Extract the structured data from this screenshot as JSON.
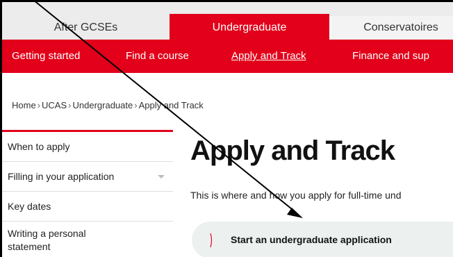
{
  "top_tabs": [
    {
      "label": "After GCSEs"
    },
    {
      "label": "Undergraduate"
    },
    {
      "label": "Conservatoires"
    }
  ],
  "nav": [
    {
      "label": "Getting started"
    },
    {
      "label": "Find a course"
    },
    {
      "label": "Apply and Track"
    },
    {
      "label": "Finance and sup"
    }
  ],
  "breadcrumb": [
    "Home",
    "UCAS",
    "Undergraduate",
    "Apply and Track"
  ],
  "breadcrumb_sep": "›",
  "sidebar": {
    "items": [
      {
        "label": "When to apply"
      },
      {
        "label": "Filling in your application"
      },
      {
        "label": "Key dates"
      },
      {
        "label": "Writing a personal statement"
      }
    ]
  },
  "main": {
    "title": "Apply and Track",
    "intro": "This is where and how you apply for full-time und",
    "cta_label": "Start an undergraduate application"
  },
  "colors": {
    "brand_red": "#e2001a",
    "cta_bg": "#ecf1f0"
  }
}
